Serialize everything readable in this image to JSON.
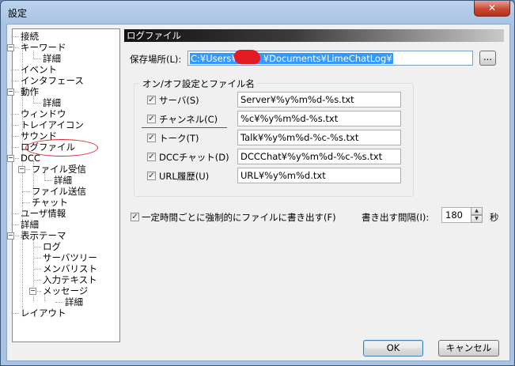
{
  "window": {
    "title": "設定",
    "close_glyph": "✕"
  },
  "tree": {
    "items": [
      {
        "label": "接続"
      },
      {
        "label": "キーワード",
        "expander": "−"
      },
      {
        "label": "詳細"
      },
      {
        "label": "イベント"
      },
      {
        "label": "インタフェース"
      },
      {
        "label": "動作",
        "expander": "−"
      },
      {
        "label": "詳細"
      },
      {
        "label": "ウィンドウ"
      },
      {
        "label": "トレイアイコン"
      },
      {
        "label": "サウンド"
      },
      {
        "label": "ログファイル",
        "selected": true
      },
      {
        "label": "DCC",
        "expander": "−"
      },
      {
        "label": "ファイル受信",
        "expander": "−"
      },
      {
        "label": "詳細"
      },
      {
        "label": "ファイル送信"
      },
      {
        "label": "チャット"
      },
      {
        "label": "ユーザ情報"
      },
      {
        "label": "詳細"
      },
      {
        "label": "表示テーマ",
        "expander": "−"
      },
      {
        "label": "ログ"
      },
      {
        "label": "サーバツリー"
      },
      {
        "label": "メンバリスト"
      },
      {
        "label": "入力テキスト"
      },
      {
        "label": "メッセージ",
        "expander": "−"
      },
      {
        "label": "詳細"
      },
      {
        "label": "レイアウト"
      }
    ]
  },
  "panel": {
    "header": "ログファイル",
    "save_location_label": "保存場所(L):",
    "save_path_prefix": "C:¥Users¥",
    "save_path_suffix": "¥Documents¥LimeChatLog¥",
    "browse_label": "...",
    "group_title": "オン/オフ設定とファイル名",
    "rows": [
      {
        "label": "サーバ(S)",
        "checked": true,
        "value": "Server¥%y%m%d-%s.txt"
      },
      {
        "label": "チャンネル(C)",
        "checked": true,
        "value": "%c¥%y%m%d-%s.txt"
      },
      {
        "label": "トーク(T)",
        "checked": true,
        "value": "Talk¥%y%m%d-%c-%s.txt"
      },
      {
        "label": "DCCチャット(D)",
        "checked": true,
        "value": "DCCChat¥%y%m%d-%c-%s.txt"
      },
      {
        "label": "URL履歴(U)",
        "checked": true,
        "value": "URL¥%y%m%d.txt"
      }
    ],
    "force_write": {
      "label": "一定時間ごとに強制的にファイルに書き出す(F)",
      "checked": true
    },
    "interval_label": "書き出す間隔(I):",
    "interval_value": "180",
    "interval_unit": "秒"
  },
  "buttons": {
    "ok": "OK",
    "cancel": "キャンセル"
  },
  "colors": {
    "selection": "#3399ff",
    "annotation_red": "#e0202a"
  }
}
